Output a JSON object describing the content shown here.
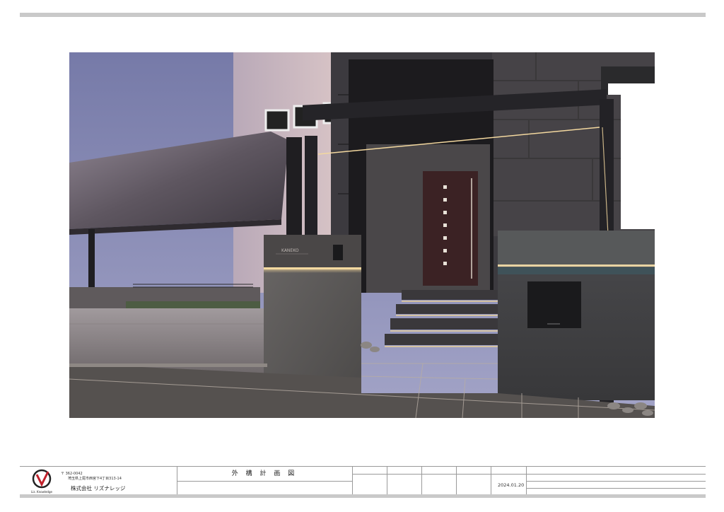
{
  "company": {
    "logo_caption": "Liz. Knowledge",
    "postal": "〒 362-0042",
    "address": "埼玉県上尾市西宮下4丁目313-14",
    "name": "株式会社 リズナレッジ"
  },
  "drawing": {
    "title": "外 構 計 画 図",
    "date": "2024.01.20"
  },
  "render": {
    "nameplate": "KANEKO",
    "sky_color": "#8a8fb8",
    "light_color": "#f6d9a0"
  }
}
